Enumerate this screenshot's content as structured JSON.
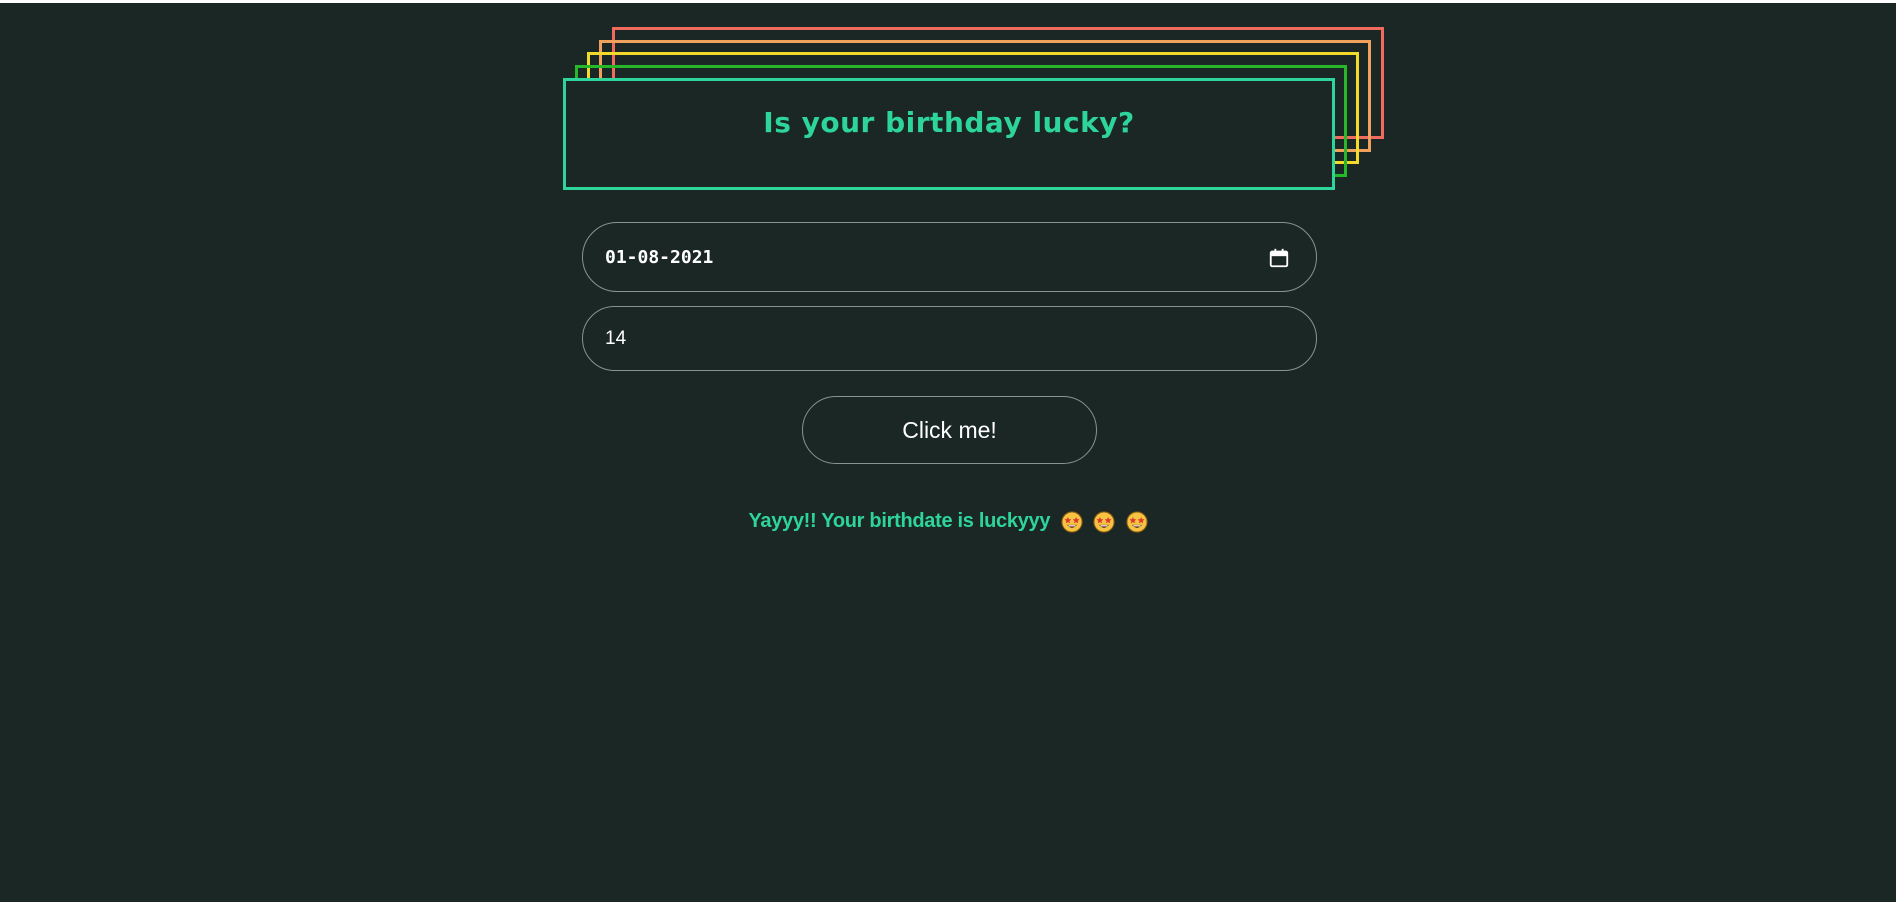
{
  "header": {
    "title": "Is your birthday lucky?"
  },
  "form": {
    "date_value": "01-08-2021",
    "lucky_number_value": "14",
    "submit_label": "Click me!"
  },
  "result": {
    "message": "Yayyy!! Your birthdate is luckyyy",
    "emoji": "star-struck-icon",
    "emoji_count": 3
  },
  "colors": {
    "background": "#1a2725",
    "accent": "#2ed59a",
    "frame_red": "#f06b5d",
    "frame_orange": "#f0a15c",
    "frame_yellow": "#f2da2a",
    "frame_green": "#27b82a"
  }
}
